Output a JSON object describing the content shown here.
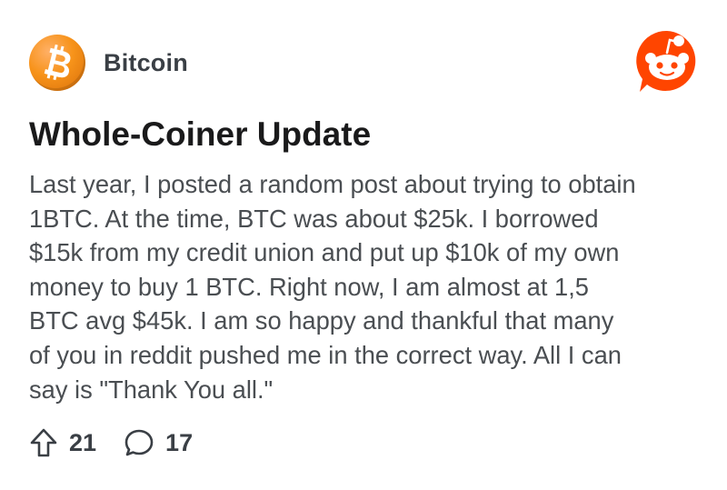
{
  "post": {
    "subreddit": "Bitcoin",
    "title": "Whole-Coiner Update",
    "body": "Last year, I posted a random post about trying to obtain\n1BTC. At the time, BTC was about $25k. I borrowed\n$15k from my credit union and put up $10k of my own\nmoney to buy 1 BTC. Right now, I am almost at 1,5\nBTC avg $45k. I am so happy and thankful that many\nof you in reddit pushed me in the correct way. All I can\nsay is \"Thank You all.\"",
    "upvotes": "21",
    "comments": "17"
  },
  "icons": {
    "subreddit_avatar": "bitcoin-logo-icon",
    "app_logo": "reddit-snoo-icon",
    "upvote": "upvote-arrow-icon",
    "comment": "comment-bubble-icon"
  },
  "colors": {
    "bitcoin_orange": "#f7931a",
    "reddit_orange": "#ff4500",
    "body_text": "#4a4e52",
    "title_text": "#1a1a1b"
  }
}
